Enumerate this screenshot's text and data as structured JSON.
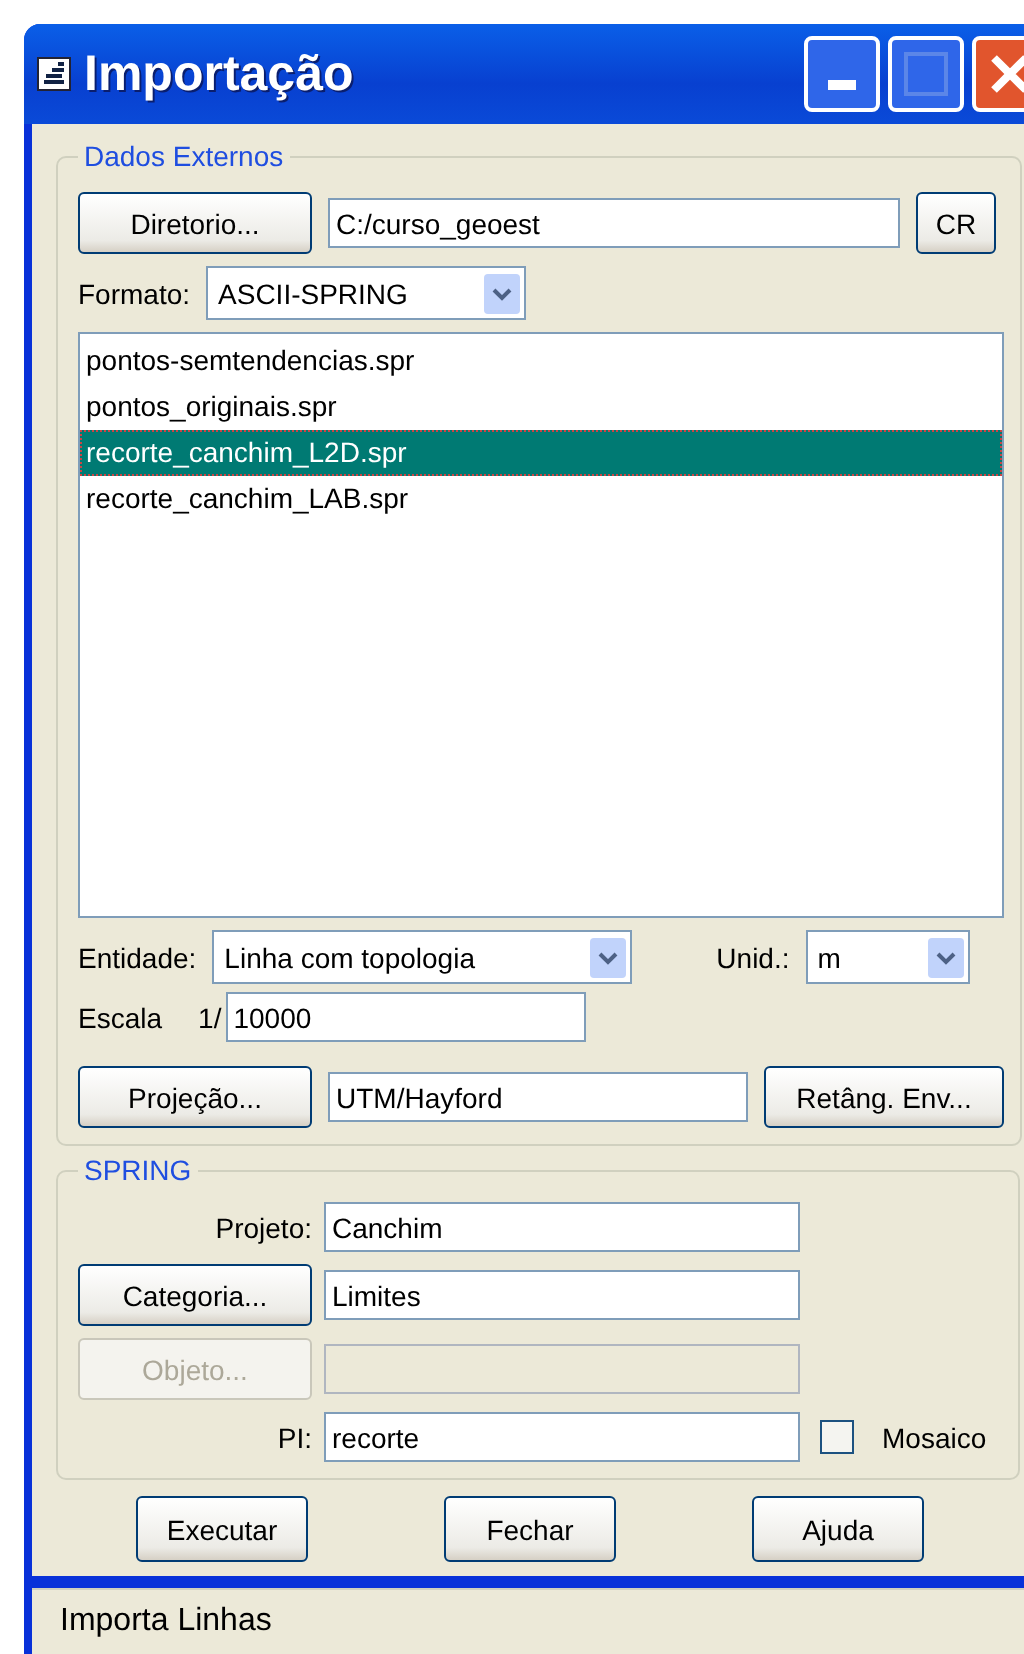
{
  "window": {
    "title": "Importação"
  },
  "external_data": {
    "legend": "Dados Externos",
    "directory_button": "Diretorio...",
    "directory": "C:/curso_geoest",
    "cr_button": "CR",
    "format_label": "Formato:",
    "format": "ASCII-SPRING",
    "files": [
      {
        "name": "pontos-semtendencias.spr",
        "selected": false
      },
      {
        "name": "pontos_originais.spr",
        "selected": false
      },
      {
        "name": "recorte_canchim_L2D.spr",
        "selected": true
      },
      {
        "name": "recorte_canchim_LAB.spr",
        "selected": false
      }
    ],
    "entity_label": "Entidade:",
    "entity": "Linha com topologia",
    "unit_label": "Unid.:",
    "unit": "m",
    "scale_label": "Escala",
    "scale_prefix": "1/",
    "scale": "10000",
    "projection_button": "Projeção...",
    "projection": "UTM/Hayford",
    "rect_button": "Retâng. Env..."
  },
  "spring": {
    "legend": "SPRING",
    "rows": [
      {
        "kind": "label",
        "label": "Projeto:",
        "value": "Canchim",
        "disabled": false
      },
      {
        "kind": "button",
        "label": "Categoria...",
        "value": "Limites",
        "disabled": false
      },
      {
        "kind": "button",
        "label": "Objeto...",
        "disabled": true
      },
      {
        "kind": "label",
        "label": "PI:",
        "value": "recorte",
        "disabled": false
      }
    ],
    "mosaic": {
      "label": "Mosaico",
      "checked": false
    }
  },
  "buttons": [
    "Executar",
    "Fechar",
    "Ajuda"
  ],
  "status_bar": "Importa Linhas"
}
